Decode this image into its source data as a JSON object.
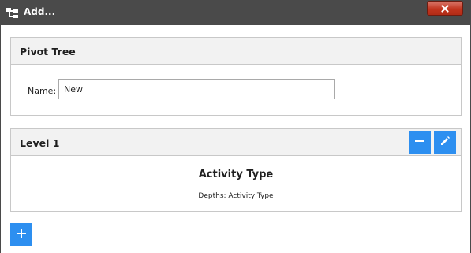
{
  "window": {
    "title": "Add...",
    "title_icon": "tree-icon",
    "close_icon": "close-icon"
  },
  "pivot_tree": {
    "header": "Pivot Tree",
    "name_label": "Name:",
    "name_value": "New"
  },
  "levels": [
    {
      "header": "Level 1",
      "name": "Activity Type",
      "depths": "Depths: Activity Type",
      "remove_icon": "minus-icon",
      "edit_icon": "pencil-icon"
    }
  ],
  "add_level_icon": "plus-icon",
  "colors": {
    "titlebar": "#4a4a4a",
    "accent_button": "#2d8ff0",
    "close_button": "#c2351f",
    "panel_header": "#f2f2f2",
    "panel_border": "#c8c8c8"
  }
}
